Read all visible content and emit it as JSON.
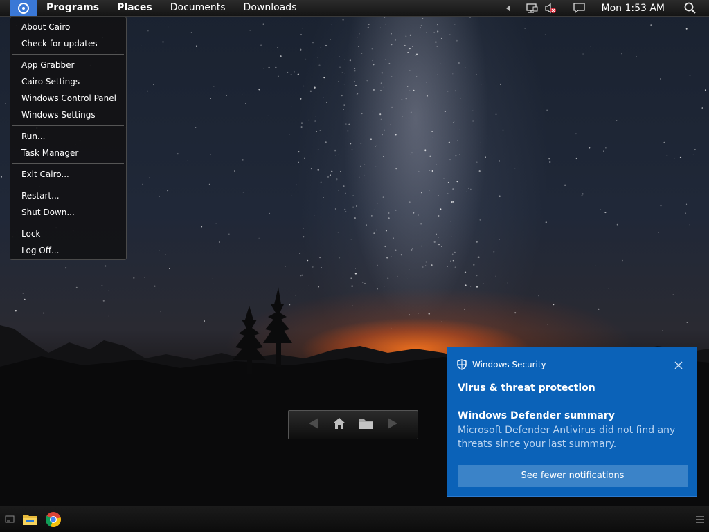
{
  "menubar": {
    "items": [
      {
        "label": "Programs",
        "bold": true
      },
      {
        "label": "Places",
        "bold": true
      },
      {
        "label": "Documents",
        "bold": false
      },
      {
        "label": "Downloads",
        "bold": false
      }
    ],
    "clock": "Mon 1:53 AM",
    "tray_icons": [
      "chevron-left-icon",
      "network-icon",
      "volume-muted-icon",
      "action-center-icon",
      "search-icon"
    ]
  },
  "cairo_menu": {
    "groups": [
      [
        "About Cairo",
        "Check for updates"
      ],
      [
        "App Grabber",
        "Cairo Settings",
        "Windows Control Panel",
        "Windows Settings"
      ],
      [
        "Run...",
        "Task Manager"
      ],
      [
        "Exit Cairo..."
      ],
      [
        "Restart...",
        "Shut Down..."
      ],
      [
        "Lock",
        "Log Off..."
      ]
    ]
  },
  "notification": {
    "app": "Windows Security",
    "title": "Virus & threat protection",
    "subtitle": "Windows Defender summary",
    "body": "Microsoft Defender Antivirus did not find any threats since your last summary.",
    "button": "See fewer notifications",
    "colors": {
      "background": "#0b62b8",
      "button": "#3b83c8"
    }
  },
  "navwidget": {
    "icons": [
      "back-arrow-icon",
      "home-icon",
      "folder-icon",
      "forward-arrow-icon"
    ]
  },
  "taskbar": {
    "icons": [
      "desktop-icon",
      "file-explorer-icon",
      "chrome-icon",
      "menu-icon"
    ]
  },
  "colors": {
    "accent": "#3a78d6"
  }
}
